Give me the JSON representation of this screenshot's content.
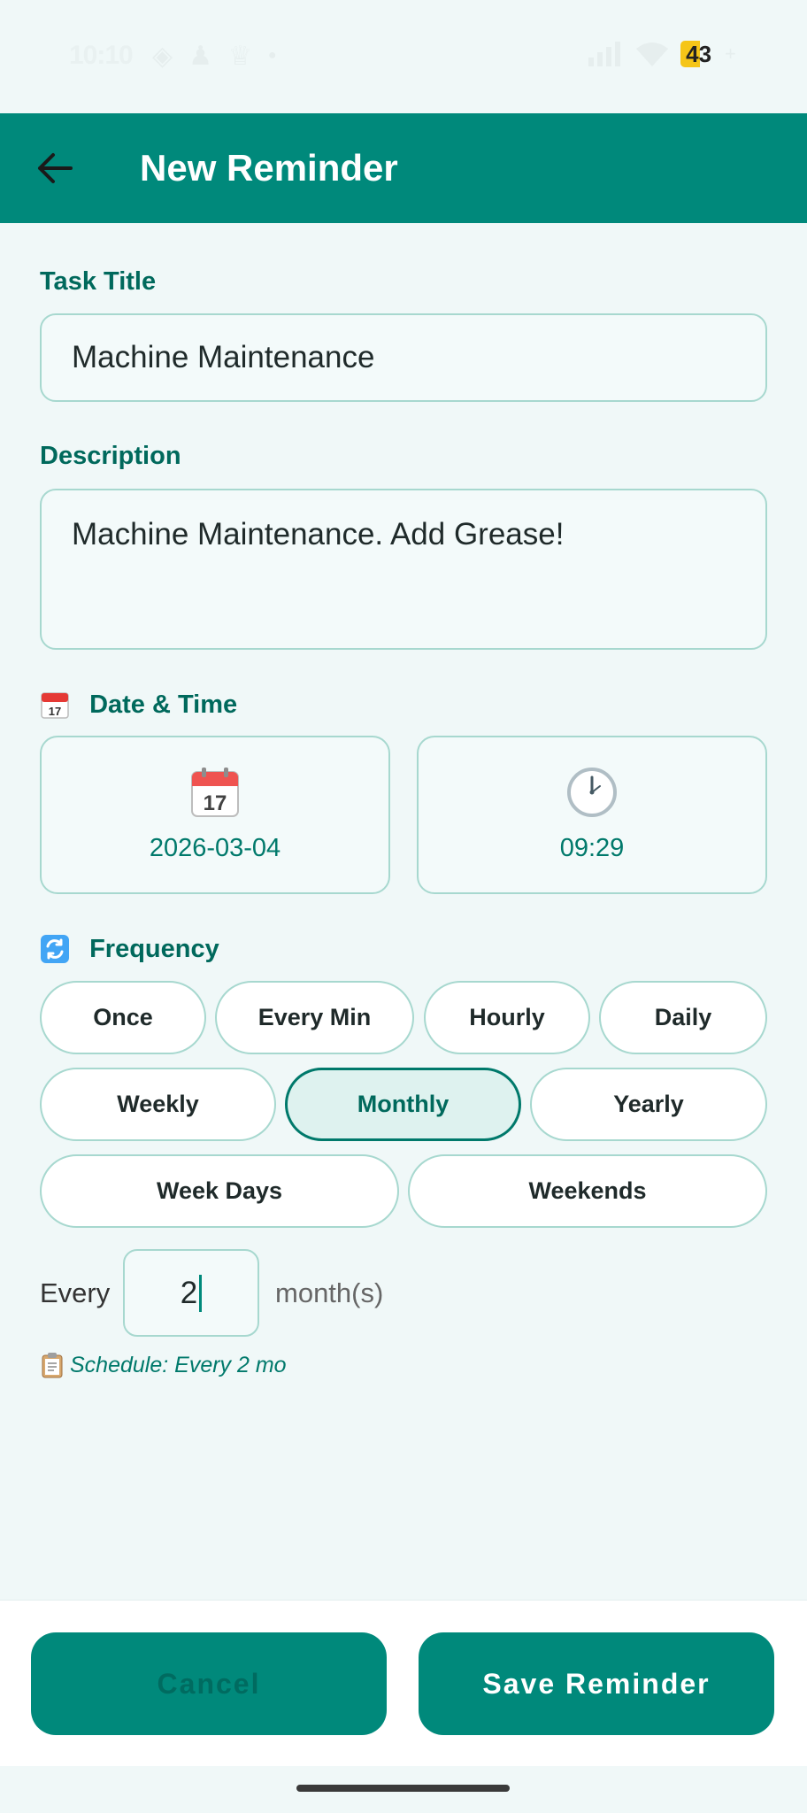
{
  "status_bar": {
    "time": "10:10",
    "battery": "43"
  },
  "app_bar": {
    "title": "New Reminder"
  },
  "form": {
    "task_title_label": "Task Title",
    "task_title_value": "Machine Maintenance",
    "description_label": "Description",
    "description_value": "Machine Maintenance. Add Grease!",
    "date_time_label": "Date & Time",
    "date_value": "2026-03-04",
    "time_value": "09:29",
    "frequency_label": "Frequency",
    "frequency_options": [
      "Once",
      "Every Min",
      "Hourly",
      "Daily",
      "Weekly",
      "Monthly",
      "Yearly",
      "Week Days",
      "Weekends"
    ],
    "selected_frequency": "Monthly",
    "every_label": "Every",
    "interval_value": "2",
    "unit_label": "month(s)",
    "schedule_summary": "Schedule: Every 2 mo"
  },
  "actions": {
    "cancel_label": "Cancel",
    "save_label": "Save Reminder"
  },
  "colors": {
    "primary": "#00897b",
    "primary_dark": "#00695c",
    "border": "#a7d8cf",
    "background": "#f0f8f8"
  }
}
